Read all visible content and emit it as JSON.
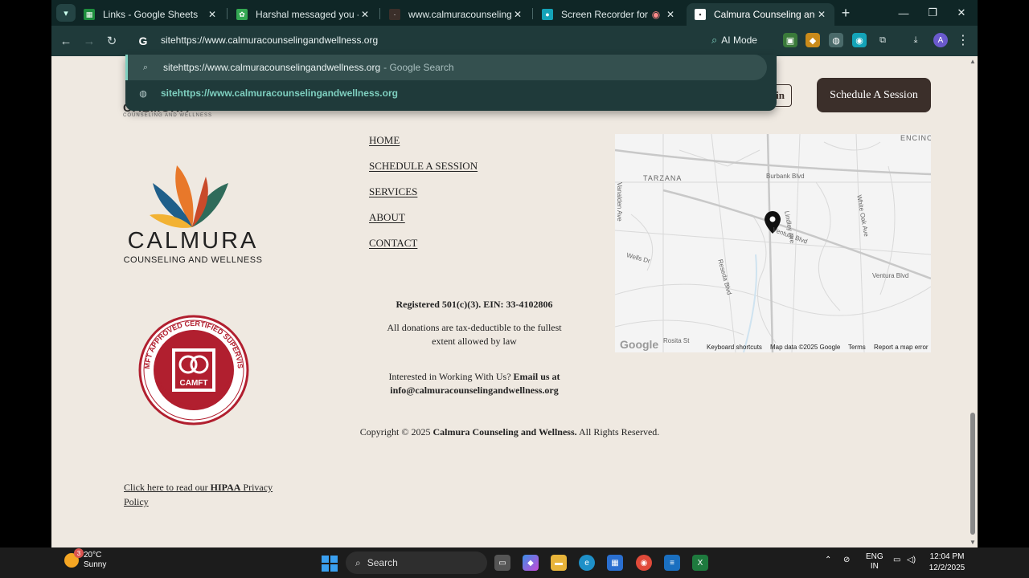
{
  "browser": {
    "tabs": [
      {
        "title": "Links - Google Sheets",
        "favicon_color": "#1e8e3e",
        "favicon_icon": "sheets-icon",
        "active": false
      },
      {
        "title": "Harshal messaged you - Chat",
        "favicon_color": "#34a853",
        "favicon_icon": "chat-icon",
        "active": false
      },
      {
        "title": "www.calmuracounselingandwe",
        "favicon_color": "#3b2f2a",
        "favicon_icon": "site-icon",
        "active": false
      },
      {
        "title": "Screen Recorder for Googl",
        "favicon_color": "#14a3b8",
        "favicon_icon": "recorder-icon",
        "active": false
      },
      {
        "title": "Calmura Counseling and Welln",
        "favicon_color": "#ffffff",
        "favicon_icon": "page-icon",
        "active": true
      }
    ],
    "omnibox_text": "sitehttps://www.calmuracounselingandwellness.org",
    "ai_mode_label": "AI Mode",
    "profile_initial": "A",
    "dropdown": [
      {
        "text": "sitehttps://www.calmuracounselingandwellness.org",
        "hint": " - Google Search",
        "icon": "search-icon"
      },
      {
        "text": "sitehttps://www.calmuracounselingandwellness.org",
        "hint": "",
        "icon": "globe-icon"
      }
    ]
  },
  "site": {
    "login_label": "in",
    "schedule_label": "Schedule A Session",
    "small_logo": "CALMURA",
    "small_logo_sub": "COUNSELING AND WELLNESS",
    "brand_name": "CALMURA",
    "brand_sub": "COUNSELING AND WELLNESS",
    "nav": [
      "HOME",
      "SCHEDULE A SESSION",
      "SERVICES",
      "ABOUT",
      "CONTACT"
    ],
    "registered": "Registered 501(c)(3). EIN: 33-4102806",
    "donations": "All donations are tax-deductible to the fullest extent allowed by law",
    "work_prefix": "Interested in Working With Us? ",
    "work_email_label": "Email us at",
    "email": "info@calmuracounselingandwellness.org",
    "copyright_prefix": "Copyright © 2025 ",
    "copyright_name": "Calmura Counseling and Wellness.",
    "copyright_suffix": " All Rights Reserved.",
    "hipaa_prefix": "Click here to read our ",
    "hipaa_bold": "HIPAA",
    "hipaa_suffix": " Privacy Policy",
    "badge": {
      "top": "CAMFT APPROVED CERTIFIED SUPERVISOR",
      "center": "CAMFT",
      "bottom": "GOES ABOVE AND BEYOND"
    },
    "map": {
      "labels": [
        "TARZANA",
        "Burbank Blvd",
        "Lindley Ave",
        "White Oak Ave",
        "Ventura Blvd",
        "Ventura Blvd",
        "Wells Dr",
        "Reseda Blvd",
        "Vanalden Ave",
        "ENCINO",
        "Rosita St"
      ],
      "footer": [
        "Keyboard shortcuts",
        "Map data ©2025 Google",
        "Terms",
        "Report a map error"
      ],
      "google": "Google"
    }
  },
  "taskbar": {
    "temp": "20°C",
    "condition": "Sunny",
    "weather_badge": "3",
    "search_label": "Search",
    "lang_top": "ENG",
    "lang_bottom": "IN",
    "time": "12:04 PM",
    "date": "12/2/2025"
  }
}
